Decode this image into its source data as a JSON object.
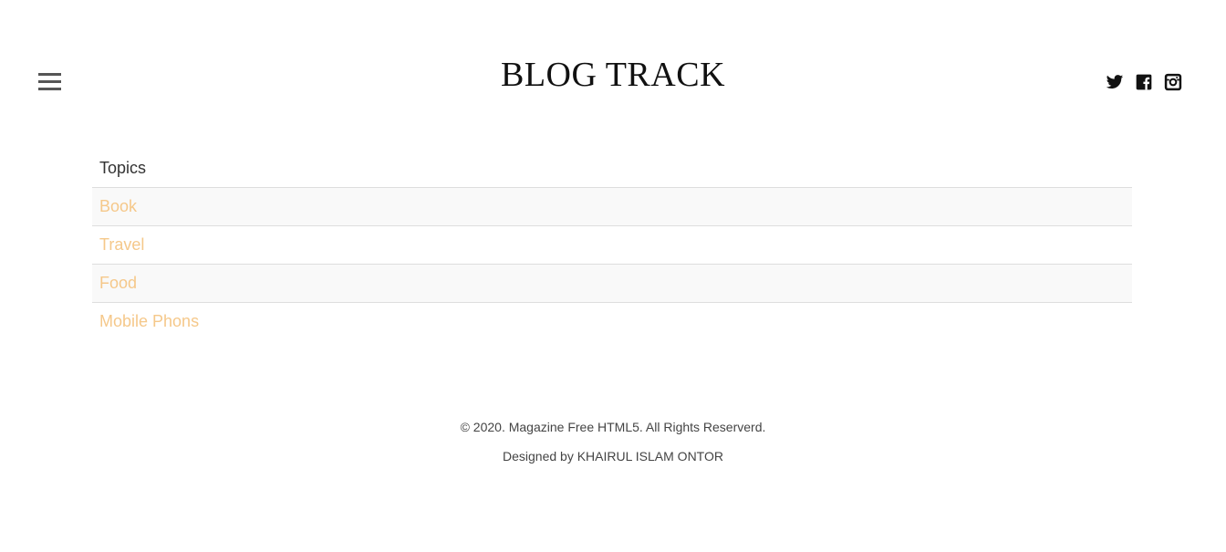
{
  "header": {
    "brand": "BLOG TRACK",
    "menu_icon": "hamburger-menu-icon",
    "social": [
      {
        "name": "twitter-icon"
      },
      {
        "name": "facebook-icon"
      },
      {
        "name": "instagram-icon"
      }
    ]
  },
  "topics": {
    "heading": "Topics",
    "items": [
      "Book",
      "Travel",
      "Food",
      "Mobile Phons"
    ],
    "link_color": "#f5c88a"
  },
  "footer": {
    "copyright": "© 2020. Magazine Free HTML5. All Rights Reserverd.",
    "designer": "Designed by KHAIRUL ISLAM ONTOR"
  }
}
